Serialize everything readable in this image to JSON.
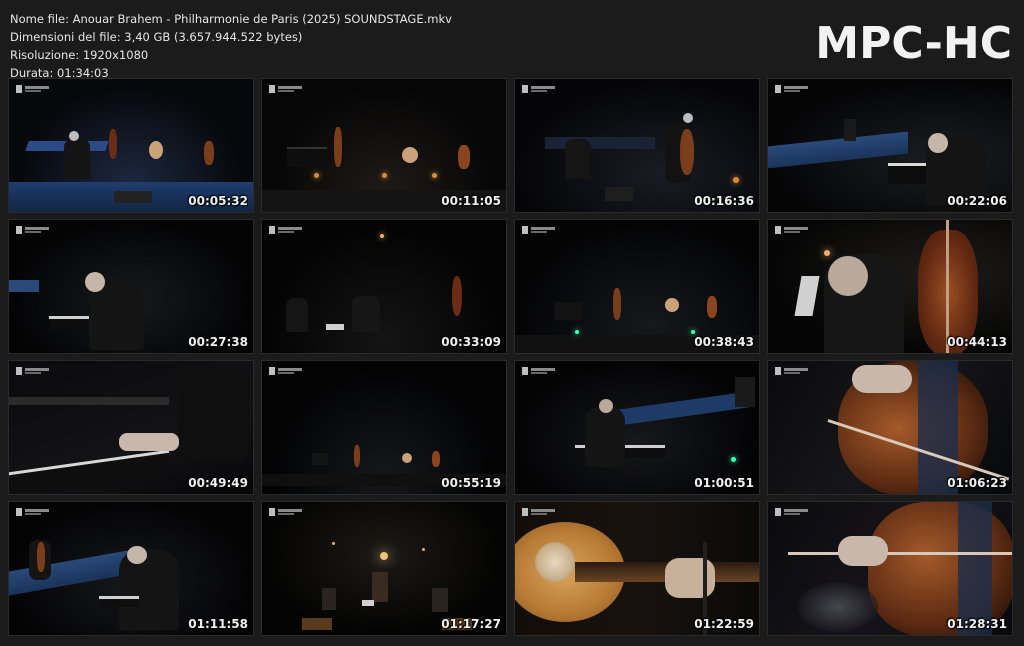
{
  "file_info": {
    "name_line": "Nome file: Anouar Brahem - Philharmonie de Paris (2025) SOUNDSTAGE.mkv",
    "size_line": "Dimensioni del file: 3,40 GB (3.657.944.522 bytes)",
    "resolution_line": "Risoluzione: 1920x1080",
    "duration_line": "Durata: 01:34:03"
  },
  "logo": "MPC-HC",
  "thumbnails": [
    {
      "timestamp": "00:05:32",
      "scene": "stage-wide-blue"
    },
    {
      "timestamp": "00:11:05",
      "scene": "stage-wide-warm"
    },
    {
      "timestamp": "00:16:36",
      "scene": "piano-bass"
    },
    {
      "timestamp": "00:22:06",
      "scene": "piano-closeup-blue"
    },
    {
      "timestamp": "00:27:38",
      "scene": "pianist-side"
    },
    {
      "timestamp": "00:33:09",
      "scene": "stage-dark"
    },
    {
      "timestamp": "00:38:43",
      "scene": "stage-wide-green"
    },
    {
      "timestamp": "00:44:13",
      "scene": "bassist-closeup"
    },
    {
      "timestamp": "00:49:49",
      "scene": "keys-hands"
    },
    {
      "timestamp": "00:55:19",
      "scene": "stage-far"
    },
    {
      "timestamp": "01:00:51",
      "scene": "pianist-mid"
    },
    {
      "timestamp": "01:06:23",
      "scene": "cello-bow"
    },
    {
      "timestamp": "01:11:58",
      "scene": "piano-bass-blue"
    },
    {
      "timestamp": "01:17:27",
      "scene": "stage-backlit"
    },
    {
      "timestamp": "01:22:59",
      "scene": "oud-closeup"
    },
    {
      "timestamp": "01:28:31",
      "scene": "cello-hand"
    }
  ],
  "colors": {
    "background": "#1b1b1b",
    "text": "#e6e6e6",
    "stage_blue": "#2a4a7a",
    "warm_light": "#d98a3a",
    "wood": "#7a3e1c"
  }
}
